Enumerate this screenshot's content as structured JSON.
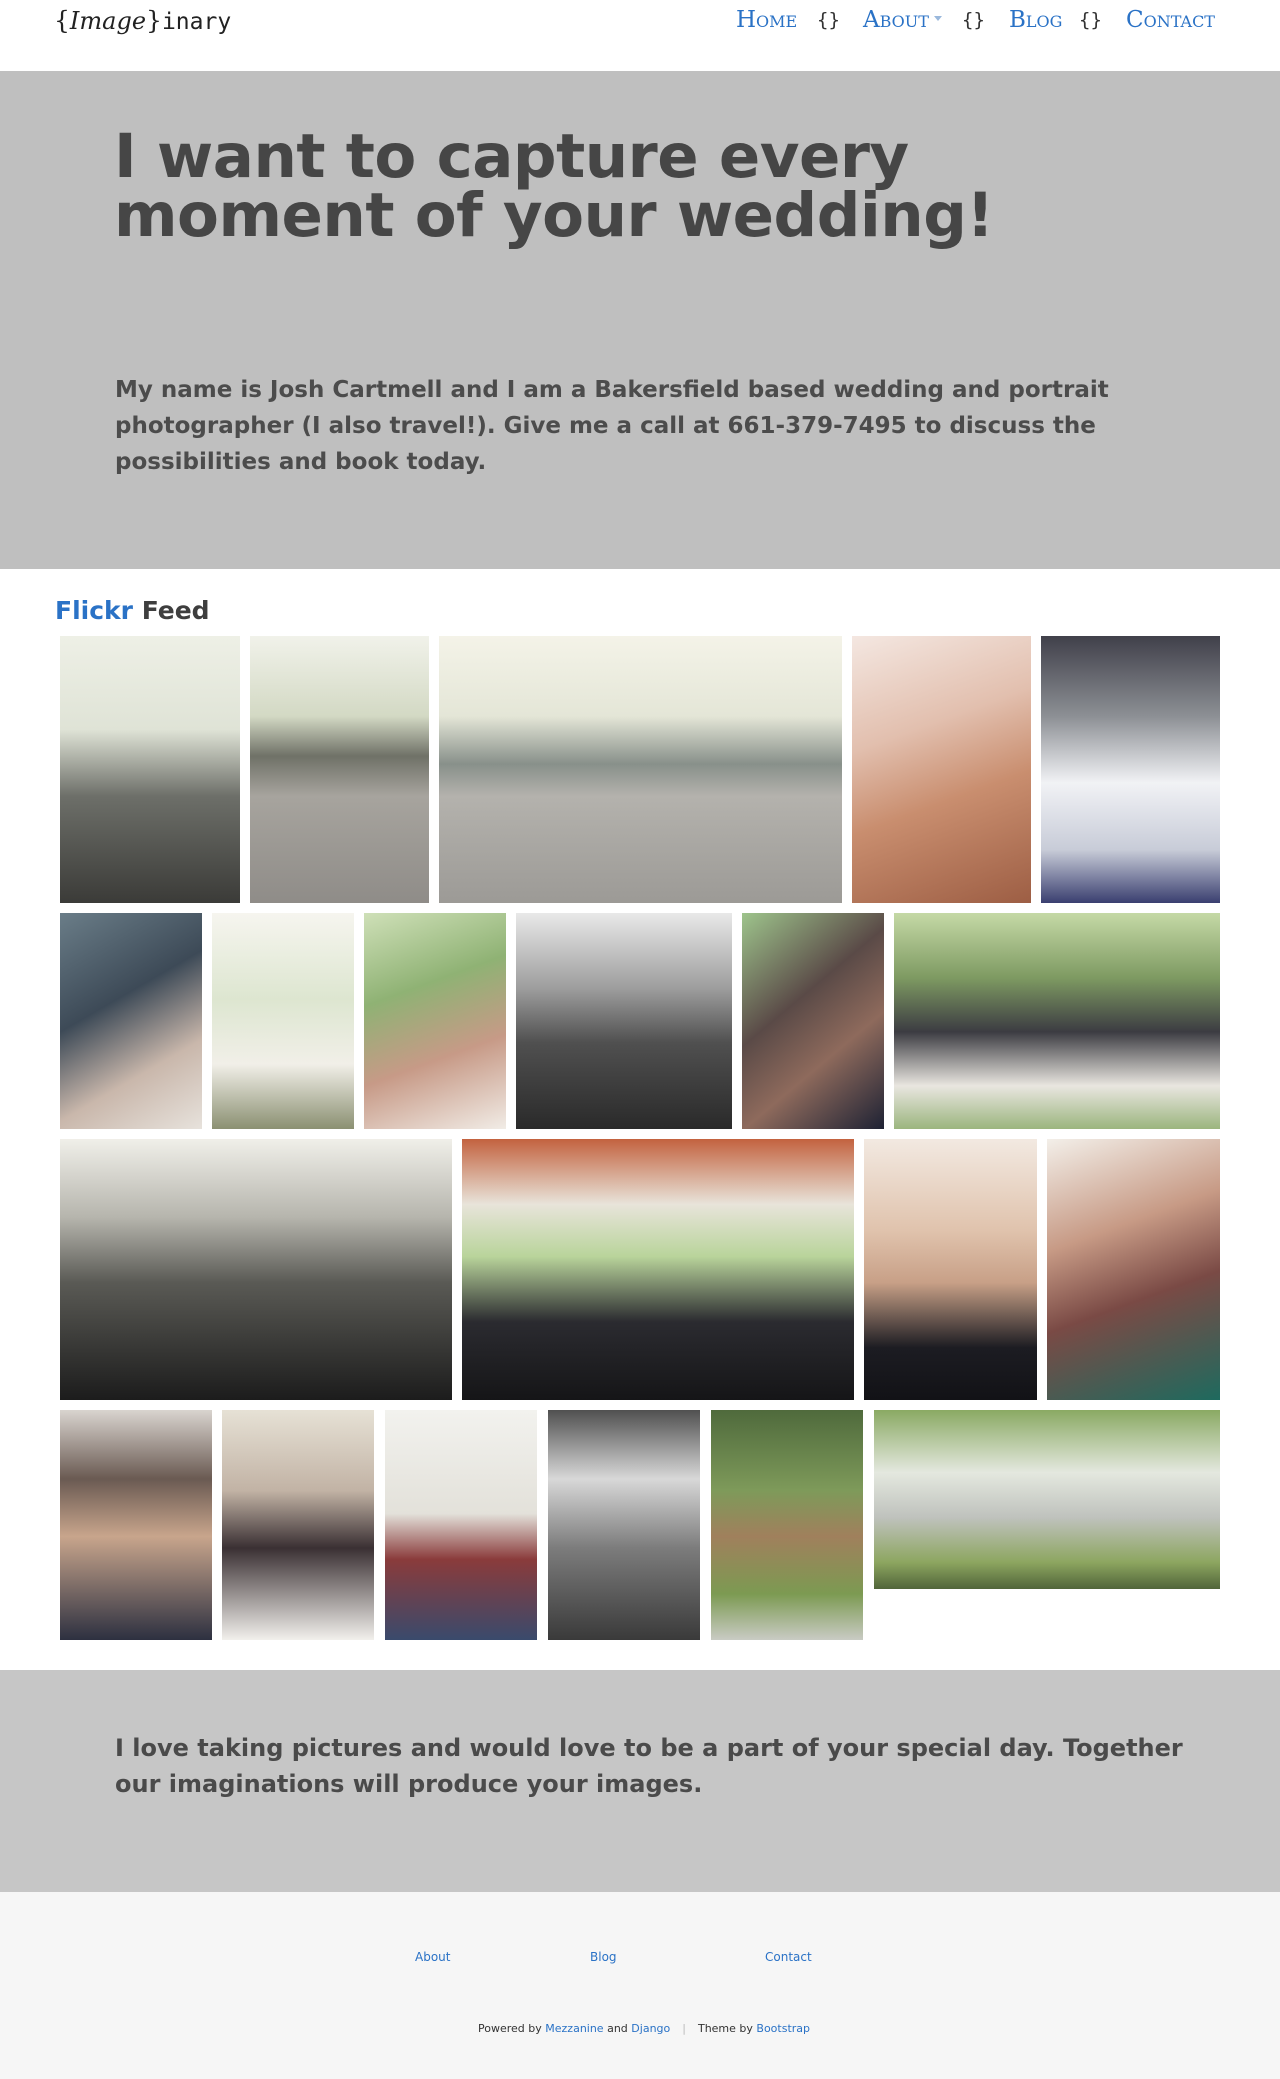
{
  "header": {
    "brand": {
      "open": "{",
      "script": "Image",
      "close": "}",
      "suffix": "inary"
    },
    "nav": [
      {
        "label": "Home"
      },
      {
        "label": "About"
      },
      {
        "label": "Blog"
      },
      {
        "label": "Contact"
      }
    ],
    "separator": "{}"
  },
  "hero": {
    "heading": "I want to capture every moment of your wedding!",
    "intro": "My name is Josh Cartmell and I am a Bakersfield based wedding and portrait photographer (I also travel!). Give me a call at 661-379-7495 to discuss the possibilities and book today."
  },
  "feed": {
    "title_link": "Flickr",
    "title_rest": " Feed"
  },
  "callout": {
    "text": "I love taking pictures and would love to be a part of your special day. Together our imaginations will produce your images."
  },
  "footer": {
    "links": [
      {
        "label": "About"
      },
      {
        "label": "Blog"
      },
      {
        "label": "Contact"
      }
    ],
    "credit": {
      "powered_by": "Powered by ",
      "mezzanine": "Mezzanine",
      "and": " and ",
      "django": "Django",
      "theme_by": "Theme by ",
      "bootstrap": "Bootstrap"
    }
  }
}
